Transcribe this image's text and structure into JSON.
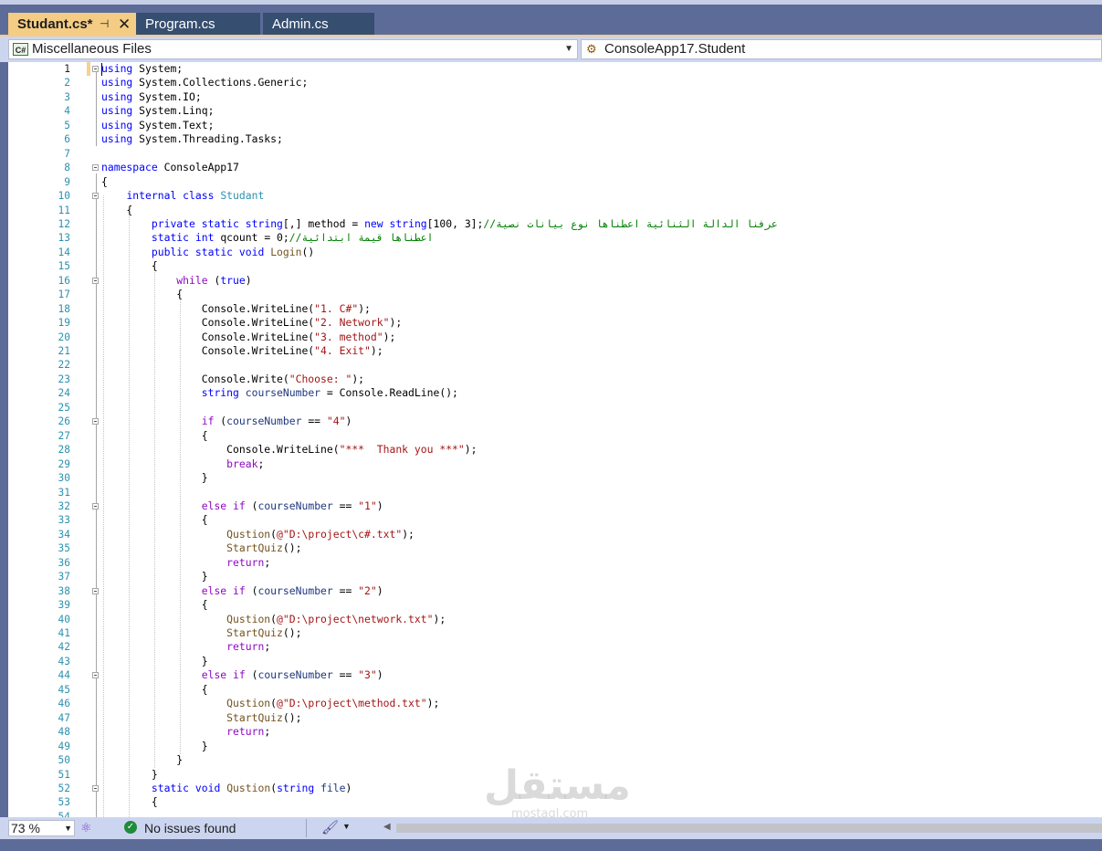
{
  "tabs": [
    {
      "label": "Studant.cs*",
      "active": true
    },
    {
      "label": "Program.cs",
      "active": false
    },
    {
      "label": "Admin.cs",
      "active": false
    }
  ],
  "navbar": {
    "project_icon": "C#",
    "project": "Miscellaneous Files",
    "member": "ConsoleApp17.Student"
  },
  "editor": {
    "code": [
      {
        "n": "1",
        "t": "using System;"
      },
      {
        "n": "2",
        "t": "using System.Collections.Generic;"
      },
      {
        "n": "3",
        "t": "using System.IO;"
      },
      {
        "n": "4",
        "t": "using System.Linq;"
      },
      {
        "n": "5",
        "t": "using System.Text;"
      },
      {
        "n": "6",
        "t": "using System.Threading.Tasks;"
      },
      {
        "n": "7",
        "t": ""
      },
      {
        "n": "8",
        "t": "namespace ConsoleApp17"
      },
      {
        "n": "9",
        "t": "{"
      },
      {
        "n": "10",
        "t": "    internal class Studant"
      },
      {
        "n": "11",
        "t": "    {"
      },
      {
        "n": "12",
        "t": "        private static string[,] method = new string[100, 3];//عرفنا الدالة الثنائية اعطناها نوع بيانات نصية"
      },
      {
        "n": "13",
        "t": "        static int qcount = 0;//اعطناها قيمة ابتدائية"
      },
      {
        "n": "14",
        "t": "        public static void Login()"
      },
      {
        "n": "15",
        "t": "        {"
      },
      {
        "n": "16",
        "t": "            while (true)"
      },
      {
        "n": "17",
        "t": "            {"
      },
      {
        "n": "18",
        "t": "                Console.WriteLine(\"1. C#\");"
      },
      {
        "n": "19",
        "t": "                Console.WriteLine(\"2. Network\");"
      },
      {
        "n": "20",
        "t": "                Console.WriteLine(\"3. method\");"
      },
      {
        "n": "21",
        "t": "                Console.WriteLine(\"4. Exit\");"
      },
      {
        "n": "22",
        "t": ""
      },
      {
        "n": "23",
        "t": "                Console.Write(\"Choose: \");"
      },
      {
        "n": "24",
        "t": "                string courseNumber = Console.ReadLine();"
      },
      {
        "n": "25",
        "t": ""
      },
      {
        "n": "26",
        "t": "                if (courseNumber == \"4\")"
      },
      {
        "n": "27",
        "t": "                {"
      },
      {
        "n": "28",
        "t": "                    Console.WriteLine(\"***  Thank you ***\");"
      },
      {
        "n": "29",
        "t": "                    break;"
      },
      {
        "n": "30",
        "t": "                }"
      },
      {
        "n": "31",
        "t": ""
      },
      {
        "n": "32",
        "t": "                else if (courseNumber == \"1\")"
      },
      {
        "n": "33",
        "t": "                {"
      },
      {
        "n": "34",
        "t": "                    Qustion(@\"D:\\project\\c#.txt\");"
      },
      {
        "n": "35",
        "t": "                    StartQuiz();"
      },
      {
        "n": "36",
        "t": "                    return;"
      },
      {
        "n": "37",
        "t": "                }"
      },
      {
        "n": "38",
        "t": "                else if (courseNumber == \"2\")"
      },
      {
        "n": "39",
        "t": "                {"
      },
      {
        "n": "40",
        "t": "                    Qustion(@\"D:\\project\\network.txt\");"
      },
      {
        "n": "41",
        "t": "                    StartQuiz();"
      },
      {
        "n": "42",
        "t": "                    return;"
      },
      {
        "n": "43",
        "t": "                }"
      },
      {
        "n": "44",
        "t": "                else if (courseNumber == \"3\")"
      },
      {
        "n": "45",
        "t": "                {"
      },
      {
        "n": "46",
        "t": "                    Qustion(@\"D:\\project\\method.txt\");"
      },
      {
        "n": "47",
        "t": "                    StartQuiz();"
      },
      {
        "n": "48",
        "t": "                    return;"
      },
      {
        "n": "49",
        "t": "                }"
      },
      {
        "n": "50",
        "t": "            }"
      },
      {
        "n": "51",
        "t": "        }"
      },
      {
        "n": "52",
        "t": "        static void Qustion(string file)"
      },
      {
        "n": "53",
        "t": "        {"
      },
      {
        "n": "54",
        "t": ""
      }
    ]
  },
  "watermark": {
    "text": "مستقل",
    "sub": "mostaql.com"
  },
  "status": {
    "zoom": "73 %",
    "issues": "No issues found"
  },
  "icons": {
    "project": "csharp-file-icon",
    "member": "class-icon",
    "issues": "check-circle-icon",
    "cleanup": "broom-icon",
    "intellicode": "brain-icon"
  }
}
